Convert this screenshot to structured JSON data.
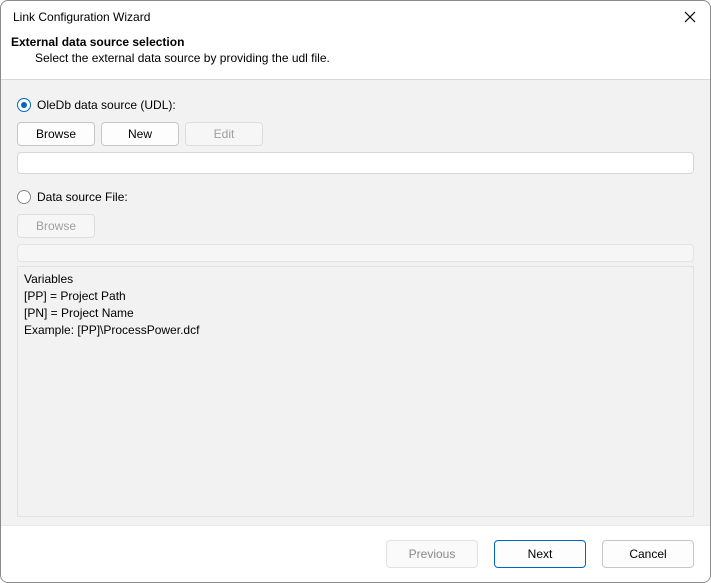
{
  "window": {
    "title": "Link Configuration Wizard"
  },
  "header": {
    "title": "External data source selection",
    "subtitle": "Select the external data source by providing the udl file."
  },
  "option_udl": {
    "label": "OleDb data source (UDL):",
    "checked": true,
    "browse_label": "Browse",
    "new_label": "New",
    "edit_label": "Edit",
    "path_value": ""
  },
  "option_file": {
    "label": "Data source File:",
    "checked": false,
    "browse_label": "Browse",
    "path_value": ""
  },
  "variables": {
    "heading": "Variables",
    "line1": "[PP] =   Project Path",
    "line2": "[PN] =   Project Name",
    "line3": "Example: [PP]\\ProcessPower.dcf"
  },
  "footer": {
    "previous": "Previous",
    "next": "Next",
    "cancel": "Cancel"
  }
}
